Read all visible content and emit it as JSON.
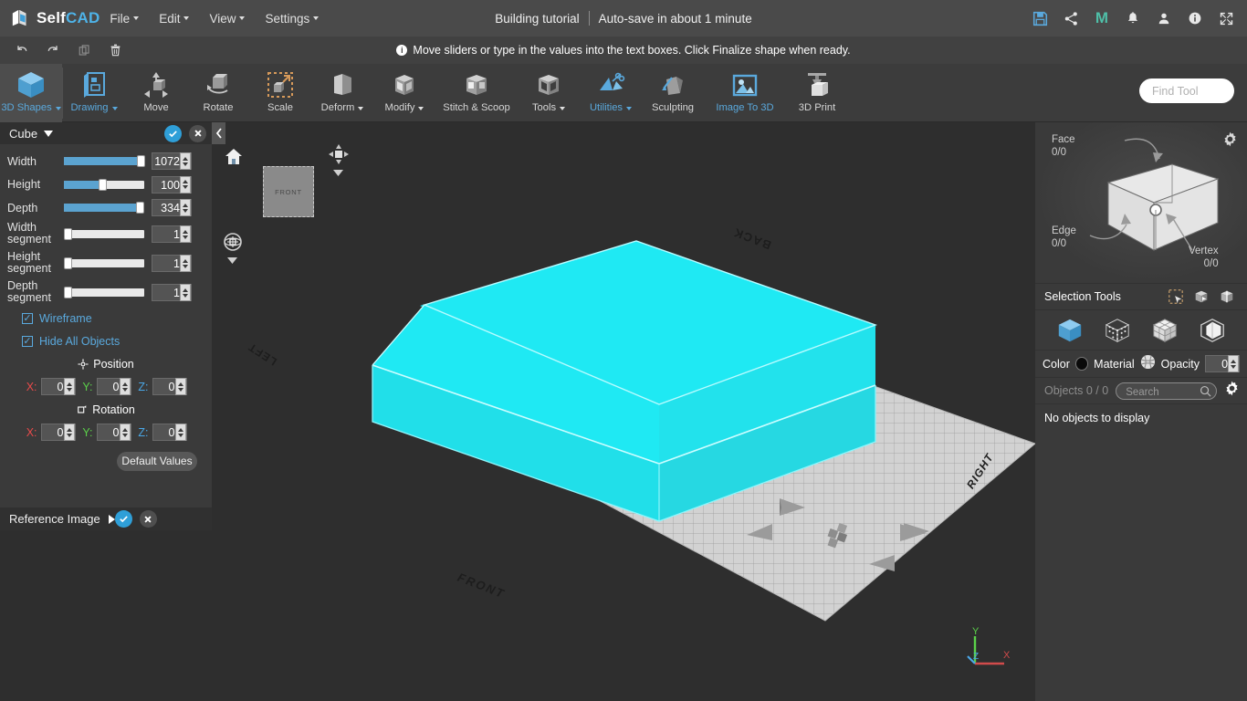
{
  "app": {
    "brand_first": "Self",
    "brand_second": "CAD",
    "project_title": "Building tutorial",
    "autosave": "Auto-save in about 1 minute"
  },
  "menu": [
    {
      "label": "File",
      "caret": true
    },
    {
      "label": "Edit",
      "caret": true
    },
    {
      "label": "View",
      "caret": true
    },
    {
      "label": "Settings",
      "caret": true
    }
  ],
  "header_icons": [
    {
      "name": "save-icon",
      "color": "#5aa9dd"
    },
    {
      "name": "share-icon",
      "color": "#e8e8e8"
    },
    {
      "name": "mirror-m-icon",
      "color": "#4fbfa8",
      "glyph": "M"
    },
    {
      "name": "notifications-bell-icon",
      "color": "#e8e8e8"
    },
    {
      "name": "user-account-icon",
      "color": "#e8e8e8"
    },
    {
      "name": "info-icon",
      "color": "#e8e8e8"
    },
    {
      "name": "fullscreen-icon",
      "color": "#e8e8e8"
    }
  ],
  "hintbar": {
    "message": "Move sliders or type in the values into the text boxes. Click Finalize shape when ready.",
    "tools": [
      "undo-icon",
      "redo-icon",
      "copy-icon",
      "delete-icon"
    ]
  },
  "ribbon": {
    "items": [
      {
        "label": "3D Shapes",
        "caret": true,
        "active": true,
        "blue_label": true,
        "icon": "cube-icon"
      },
      {
        "label": "Drawing",
        "caret": true,
        "active": false,
        "blue_label": true,
        "icon": "drawing-icon"
      },
      {
        "label": "Move",
        "caret": false,
        "active": false,
        "blue_label": false,
        "icon": "move-icon"
      },
      {
        "label": "Rotate",
        "caret": false,
        "active": false,
        "blue_label": false,
        "icon": "rotate-icon"
      },
      {
        "label": "Scale",
        "caret": false,
        "active": false,
        "blue_label": false,
        "icon": "scale-icon"
      },
      {
        "label": "Deform",
        "caret": true,
        "active": false,
        "blue_label": false,
        "icon": "deform-icon"
      },
      {
        "label": "Modify",
        "caret": true,
        "active": false,
        "blue_label": false,
        "icon": "modify-icon"
      },
      {
        "label": "Stitch & Scoop",
        "caret": false,
        "active": false,
        "blue_label": false,
        "icon": "stitch-scoop-icon"
      },
      {
        "label": "Tools",
        "caret": true,
        "active": false,
        "blue_label": false,
        "icon": "tools-icon"
      },
      {
        "label": "Utilities",
        "caret": true,
        "active": false,
        "blue_label": true,
        "icon": "utilities-icon"
      },
      {
        "label": "Sculpting",
        "caret": false,
        "active": false,
        "blue_label": false,
        "icon": "sculpting-icon"
      },
      {
        "label": "Image To 3D",
        "caret": false,
        "active": false,
        "blue_label": true,
        "icon": "image-to-3d-icon"
      },
      {
        "label": "3D Print",
        "caret": false,
        "active": false,
        "blue_label": false,
        "icon": "3d-print-icon"
      }
    ],
    "find_tool_placeholder": "Find Tool",
    "find_tool_value": ""
  },
  "left_panel": {
    "title": "Cube",
    "sliders": [
      {
        "label": "Width",
        "value": "1072",
        "fill_pct": 96
      },
      {
        "label": "Height",
        "value": "100",
        "fill_pct": 48
      },
      {
        "label": "Depth",
        "value": "334",
        "fill_pct": 94
      },
      {
        "label": "Width segment",
        "value": "1",
        "fill_pct": 0
      },
      {
        "label": "Height segment",
        "value": "1",
        "fill_pct": 0
      },
      {
        "label": "Depth segment",
        "value": "1",
        "fill_pct": 0
      }
    ],
    "checkboxes": [
      {
        "label": "Wireframe",
        "checked": true
      },
      {
        "label": "Hide All Objects",
        "checked": true
      }
    ],
    "position": {
      "heading": "Position",
      "x": "0",
      "y": "0",
      "z": "0"
    },
    "rotation": {
      "heading": "Rotation",
      "x": "0",
      "y": "0",
      "z": "0"
    },
    "default_values_label": "Default Values",
    "reference_image_label": "Reference Image"
  },
  "viewport": {
    "grid_labels": {
      "back": "BACK",
      "front": "FRONT",
      "left": "LEFT",
      "right": "RIGHT"
    },
    "view_cube_label": "FRONT",
    "axis": {
      "x": "X",
      "y": "Y",
      "z": "Z"
    },
    "axis_colors": {
      "x": "#d14b4b",
      "y": "#5bd14a",
      "z": "#4aa8e8"
    },
    "object_color": "#18e8f0",
    "icons": [
      "home-icon",
      "view-mode-icon",
      "orbit-icon"
    ]
  },
  "right_panel": {
    "selection_counts": [
      {
        "label": "Face",
        "value": "0/0"
      },
      {
        "label": "Edge",
        "value": "0/0"
      },
      {
        "label": "Vertex",
        "value": "0/0"
      }
    ],
    "selection_tools_label": "Selection Tools",
    "selection_tool_icons": [
      "rect-select-icon",
      "box-select-icon",
      "loop-select-icon"
    ],
    "selection_mode_icons": [
      "object-mode-icon",
      "vertex-mode-icon",
      "edge-mode-icon",
      "face-mode-icon"
    ],
    "color_label": "Color",
    "color_value": "#0a0a0a",
    "material_label": "Material",
    "opacity_label": "Opacity",
    "opacity_value": "0",
    "objects_label": "Objects 0 / 0",
    "search_placeholder": "Search",
    "search_value": "",
    "empty_message": "No objects to display"
  }
}
